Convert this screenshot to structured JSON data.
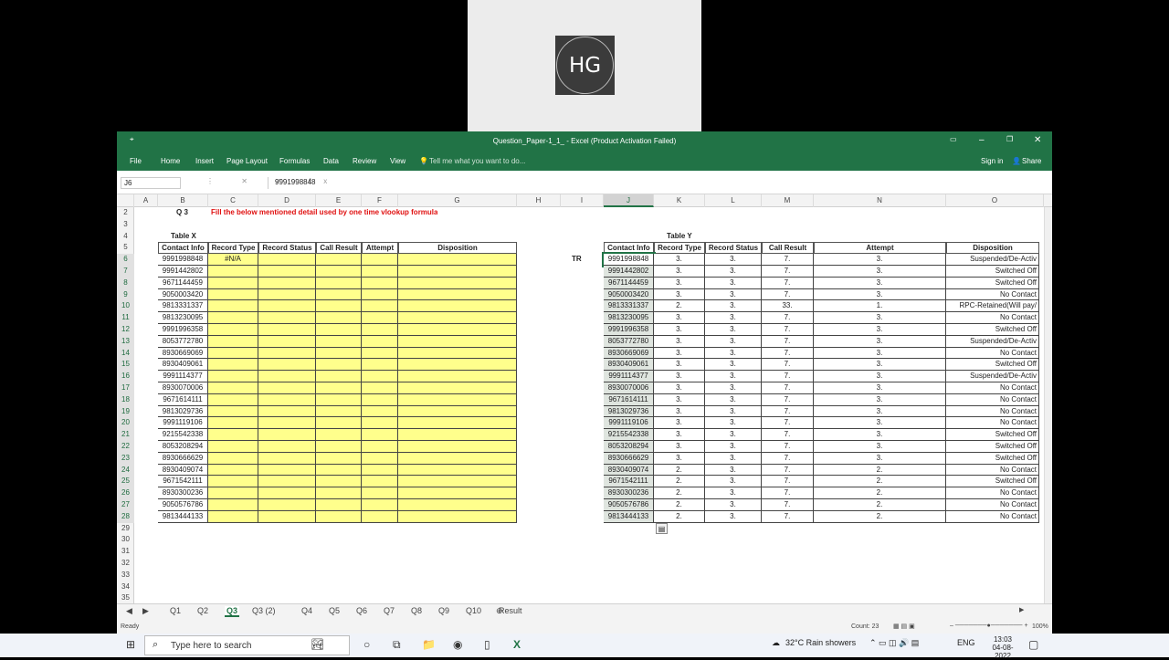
{
  "video": {
    "initials": "HG"
  },
  "window": {
    "title": "Question_Paper-1_1_ - Excel (Product Activation Failed)",
    "autosave": "⌖"
  },
  "ribbon": {
    "tabs": [
      "File",
      "Home",
      "Insert",
      "Page Layout",
      "Formulas",
      "Data",
      "Review",
      "View"
    ],
    "tell_me": "Tell me what you want to do...",
    "sign_in": "Sign in",
    "share": "Share"
  },
  "formula_bar": {
    "name_box": "J6",
    "value": "9991998848",
    "icons": "⋮ ✕ ✓ fx"
  },
  "columns": [
    "A",
    "B",
    "C",
    "D",
    "E",
    "F",
    "G",
    "H",
    "I",
    "J",
    "K",
    "L",
    "M",
    "N",
    "O"
  ],
  "rows": [
    "2",
    "3",
    "4",
    "5",
    "6",
    "7",
    "8",
    "9",
    "10",
    "11",
    "12",
    "13",
    "14",
    "15",
    "16",
    "17",
    "18",
    "19",
    "20",
    "21",
    "22",
    "23",
    "24",
    "25",
    "26",
    "27",
    "28",
    "29",
    "30",
    "31",
    "32",
    "33",
    "34",
    "35"
  ],
  "question": {
    "label": "Q 3",
    "instruction": "Fill the below mentioned detail used by one time vlookup formula"
  },
  "table_x": {
    "title": "Table X",
    "headers": [
      "Contact Info",
      "Record Type",
      "Record Status",
      "Call Result",
      "Attempt",
      "Disposition"
    ],
    "contacts": [
      "9991998848",
      "9991442802",
      "9671144459",
      "9050003420",
      "9813331337",
      "9813230095",
      "9991996358",
      "8053772780",
      "8930669069",
      "8930409061",
      "9991114377",
      "8930070006",
      "9671614111",
      "9813029736",
      "9991119106",
      "9215542338",
      "8053208294",
      "8930666629",
      "8930409074",
      "9671542111",
      "8930300236",
      "9050576786",
      "9813444133"
    ],
    "first_record_type": "#N/A"
  },
  "tr_label": "TR",
  "table_y": {
    "title": "Table Y",
    "headers": [
      "Contact Info",
      "Record Type",
      "Record Status",
      "Call Result",
      "Attempt",
      "Disposition"
    ],
    "rows": [
      [
        "9991998848",
        "3.",
        "3.",
        "7.",
        "3.",
        "Suspended/De-Activ"
      ],
      [
        "9991442802",
        "3.",
        "3.",
        "7.",
        "3.",
        "Switched Off"
      ],
      [
        "9671144459",
        "3.",
        "3.",
        "7.",
        "3.",
        "Switched Off"
      ],
      [
        "9050003420",
        "3.",
        "3.",
        "7.",
        "3.",
        "No Contact"
      ],
      [
        "9813331337",
        "2.",
        "3.",
        "33.",
        "1.",
        "RPC-Retained(Will pay/"
      ],
      [
        "9813230095",
        "3.",
        "3.",
        "7.",
        "3.",
        "No Contact"
      ],
      [
        "9991996358",
        "3.",
        "3.",
        "7.",
        "3.",
        "Switched Off"
      ],
      [
        "8053772780",
        "3.",
        "3.",
        "7.",
        "3.",
        "Suspended/De-Activ"
      ],
      [
        "8930669069",
        "3.",
        "3.",
        "7.",
        "3.",
        "No Contact"
      ],
      [
        "8930409061",
        "3.",
        "3.",
        "7.",
        "3.",
        "Switched Off"
      ],
      [
        "9991114377",
        "3.",
        "3.",
        "7.",
        "3.",
        "Suspended/De-Activ"
      ],
      [
        "8930070006",
        "3.",
        "3.",
        "7.",
        "3.",
        "No Contact"
      ],
      [
        "9671614111",
        "3.",
        "3.",
        "7.",
        "3.",
        "No Contact"
      ],
      [
        "9813029736",
        "3.",
        "3.",
        "7.",
        "3.",
        "No Contact"
      ],
      [
        "9991119106",
        "3.",
        "3.",
        "7.",
        "3.",
        "No Contact"
      ],
      [
        "9215542338",
        "3.",
        "3.",
        "7.",
        "3.",
        "Switched Off"
      ],
      [
        "8053208294",
        "3.",
        "3.",
        "7.",
        "3.",
        "Switched Off"
      ],
      [
        "8930666629",
        "3.",
        "3.",
        "7.",
        "3.",
        "Switched Off"
      ],
      [
        "8930409074",
        "2.",
        "3.",
        "7.",
        "2.",
        "No Contact"
      ],
      [
        "9671542111",
        "2.",
        "3.",
        "7.",
        "2.",
        "Switched Off"
      ],
      [
        "8930300236",
        "2.",
        "3.",
        "7.",
        "2.",
        "No Contact"
      ],
      [
        "9050576786",
        "2.",
        "3.",
        "7.",
        "2.",
        "No Contact"
      ],
      [
        "9813444133",
        "2.",
        "3.",
        "7.",
        "2.",
        "No Contact"
      ]
    ]
  },
  "sheets": [
    "Q1",
    "Q2",
    "Q3",
    "Q3 (2)",
    "Q4",
    "Q5",
    "Q6",
    "Q7",
    "Q8",
    "Q9",
    "Q10",
    "Result"
  ],
  "active_sheet": "Q3",
  "status": {
    "ready": "Ready",
    "count": "Count: 23",
    "zoom": "100%"
  },
  "taskbar": {
    "search": "Type here to search",
    "weather": "32°C  Rain showers",
    "lang": "ENG",
    "time": "13:03",
    "date": "04-08-2022"
  },
  "colors": {
    "excel_green": "#217346",
    "input_yellow": "#ffff8c"
  }
}
